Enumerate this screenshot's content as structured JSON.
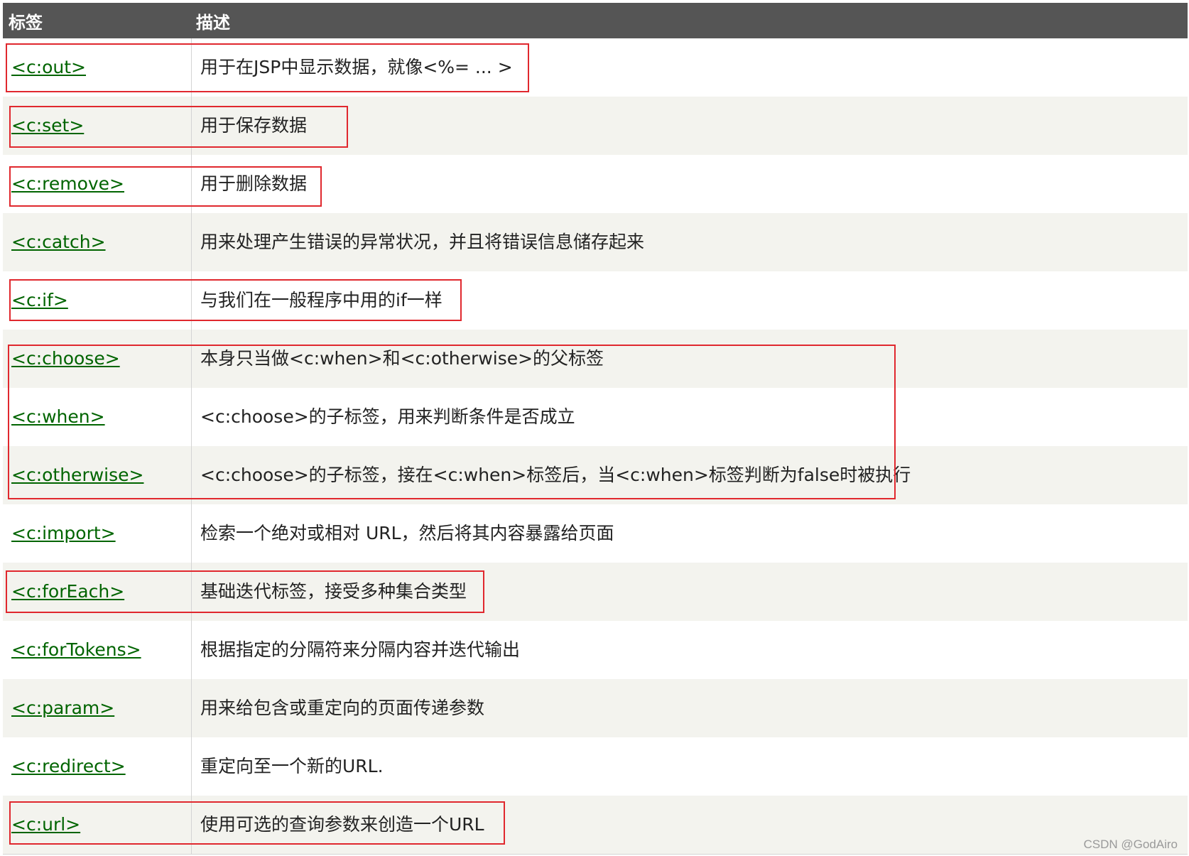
{
  "header": {
    "col_tag": "标签",
    "col_desc": "描述"
  },
  "rows": [
    {
      "tag": "<c:out>",
      "desc": "用于在JSP中显示数据，就像<%= ... >"
    },
    {
      "tag": "<c:set>",
      "desc": "用于保存数据"
    },
    {
      "tag": "<c:remove>",
      "desc": "用于删除数据"
    },
    {
      "tag": "<c:catch>",
      "desc": "用来处理产生错误的异常状况，并且将错误信息储存起来"
    },
    {
      "tag": "<c:if>",
      "desc": "与我们在一般程序中用的if一样"
    },
    {
      "tag": "<c:choose>",
      "desc": "本身只当做<c:when>和<c:otherwise>的父标签"
    },
    {
      "tag": "<c:when>",
      "desc": "<c:choose>的子标签，用来判断条件是否成立"
    },
    {
      "tag": "<c:otherwise>",
      "desc": "<c:choose>的子标签，接在<c:when>标签后，当<c:when>标签判断为false时被执行"
    },
    {
      "tag": "<c:import>",
      "desc": "检索一个绝对或相对 URL，然后将其内容暴露给页面"
    },
    {
      "tag": "<c:forEach>",
      "desc": "基础迭代标签，接受多种集合类型"
    },
    {
      "tag": "<c:forTokens>",
      "desc": "根据指定的分隔符来分隔内容并迭代输出"
    },
    {
      "tag": "<c:param>",
      "desc": "用来给包含或重定向的页面传递参数"
    },
    {
      "tag": "<c:redirect>",
      "desc": "重定向至一个新的URL."
    },
    {
      "tag": "<c:url>",
      "desc": "使用可选的查询参数来创造一个URL"
    }
  ],
  "watermark": "CSDN @GodAiro",
  "colors": {
    "header_bg": "#555555",
    "link": "#006400",
    "highlight": "#e0282e",
    "alt_row": "#f3f3ee"
  }
}
